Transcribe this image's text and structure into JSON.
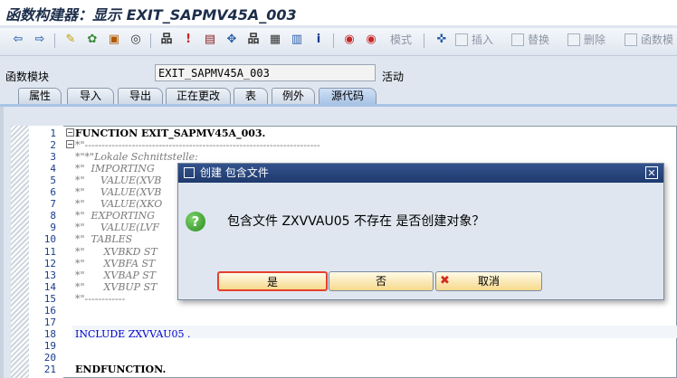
{
  "window": {
    "title": "函数构建器：显示 EXIT_SAPMV45A_003"
  },
  "toolbar": {
    "items": [
      {
        "name": "back-arrow-icon",
        "glyph": "⇦",
        "color": "#3a6fb5"
      },
      {
        "name": "forward-arrow-icon",
        "glyph": "⇨",
        "color": "#3a6fb5"
      },
      {
        "name": "display-change-icon",
        "glyph": "✎",
        "color": "#c0a000"
      },
      {
        "name": "active-inactive-icon",
        "glyph": "✿",
        "color": "#3a8a3a"
      },
      {
        "name": "check-icon",
        "glyph": "▣",
        "color": "#b35a00"
      },
      {
        "name": "activate-icon",
        "glyph": "◎",
        "color": "#333333"
      },
      {
        "name": "where-used-icon",
        "glyph": "品",
        "color": "#333333"
      },
      {
        "name": "object-list-icon",
        "glyph": "ǃ",
        "color": "#c62828"
      },
      {
        "name": "test-icon",
        "glyph": "▤",
        "color": "#8a2020"
      },
      {
        "name": "navigate-icon",
        "glyph": "✥",
        "color": "#2a5da8"
      },
      {
        "name": "hierarchy-icon",
        "glyph": "品",
        "color": "#333333"
      },
      {
        "name": "display-object-icon",
        "glyph": "▦",
        "color": "#333333"
      },
      {
        "name": "table-icon",
        "glyph": "▥",
        "color": "#2a5da8"
      },
      {
        "name": "info-icon",
        "glyph": "i",
        "color": "#1a3c8c"
      },
      {
        "name": "breakpoint-icon",
        "glyph": "◉",
        "color": "#c62828"
      },
      {
        "name": "session-breakpoint-icon",
        "glyph": "◉",
        "color": "#c62828"
      }
    ],
    "mode_label": "模式",
    "insert_label": "插入",
    "replace_label": "替换",
    "delete_label": "删除",
    "function_module_label": "函数模"
  },
  "header": {
    "function_module_label": "函数模块",
    "function_module_value": "EXIT_SAPMV45A_003",
    "status": "活动"
  },
  "tabs": [
    {
      "label": "属性",
      "active": false
    },
    {
      "label": "导入",
      "active": false
    },
    {
      "label": "导出",
      "active": false
    },
    {
      "label": "正在更改",
      "active": false
    },
    {
      "label": "表",
      "active": false
    },
    {
      "label": "例外",
      "active": false
    },
    {
      "label": "源代码",
      "active": true
    }
  ],
  "code": {
    "lines": [
      {
        "n": "1",
        "text": "FUNCTION EXIT_SAPMV45A_003."
      },
      {
        "n": "2",
        "text": "*\"----------------------------------------------------------------------"
      },
      {
        "n": "3",
        "text": "*\"*\"Lokale Schnittstelle:"
      },
      {
        "n": "4",
        "text": "*\"  IMPORTING"
      },
      {
        "n": "5",
        "text": "*\"     VALUE(XVB"
      },
      {
        "n": "6",
        "text": "*\"     VALUE(XVB"
      },
      {
        "n": "7",
        "text": "*\"     VALUE(XKO"
      },
      {
        "n": "8",
        "text": "*\"  EXPORTING"
      },
      {
        "n": "9",
        "text": "*\"     VALUE(LVF"
      },
      {
        "n": "10",
        "text": "*\"  TABLES"
      },
      {
        "n": "11",
        "text": "*\"      XVBKD ST"
      },
      {
        "n": "12",
        "text": "*\"      XVBFA ST"
      },
      {
        "n": "13",
        "text": "*\"      XVBAP ST"
      },
      {
        "n": "14",
        "text": "*\"      XVBUP ST"
      },
      {
        "n": "15",
        "text": "*\"------------"
      },
      {
        "n": "16",
        "text": ""
      },
      {
        "n": "17",
        "text": ""
      },
      {
        "n": "18",
        "text": "INCLUDE ZXVVAU05 ."
      },
      {
        "n": "19",
        "text": ""
      },
      {
        "n": "20",
        "text": ""
      },
      {
        "n": "21",
        "text": "ENDFUNCTION."
      }
    ]
  },
  "dialog": {
    "title": "创建 包含文件",
    "message": "包含文件  ZXVVAU05 不存在  是否创建对象？",
    "yes_label": "是",
    "no_label": "否",
    "cancel_label": "取消"
  }
}
